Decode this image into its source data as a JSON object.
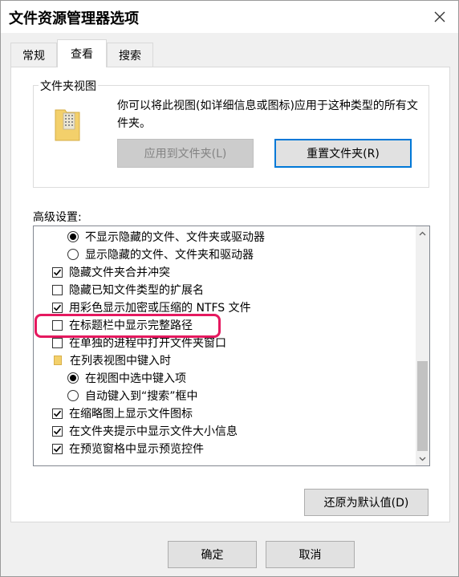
{
  "window": {
    "title": "文件资源管理器选项",
    "close_icon": "close-icon"
  },
  "tabs": [
    {
      "label": "常规",
      "active": false
    },
    {
      "label": "查看",
      "active": true
    },
    {
      "label": "搜索",
      "active": false
    }
  ],
  "folder_views": {
    "group_label": "文件夹视图",
    "icon": "folder-grid-icon",
    "description": "你可以将此视图(如详细信息或图标)应用于这种类型的所有文件夹。",
    "apply_button": "应用到文件夹(L)",
    "reset_button": "重置文件夹(R)"
  },
  "advanced": {
    "label": "高级设置:",
    "items": [
      {
        "label": "不显示隐藏的文件、文件夹或驱动器",
        "type": "radio",
        "checked": true,
        "level": 1
      },
      {
        "label": "显示隐藏的文件、文件夹和驱动器",
        "type": "radio",
        "checked": false,
        "level": 1
      },
      {
        "label": "隐藏文件夹合并冲突",
        "type": "checkbox",
        "checked": true,
        "level": 0
      },
      {
        "label": "隐藏已知文件类型的扩展名",
        "type": "checkbox",
        "checked": false,
        "level": 0
      },
      {
        "label": "用彩色显示加密或压缩的 NTFS 文件",
        "type": "checkbox",
        "checked": true,
        "level": 0
      },
      {
        "label": "在标题栏中显示完整路径",
        "type": "checkbox",
        "checked": false,
        "level": 0
      },
      {
        "label": "在单独的进程中打开文件夹窗口",
        "type": "checkbox",
        "checked": false,
        "level": 0
      },
      {
        "label": "在列表视图中键入时",
        "type": "folder",
        "checked": null,
        "level": 0
      },
      {
        "label": "在视图中选中键入项",
        "type": "radio",
        "checked": true,
        "level": 1
      },
      {
        "label": "自动键入到“搜索”框中",
        "type": "radio",
        "checked": false,
        "level": 1
      },
      {
        "label": "在缩略图上显示文件图标",
        "type": "checkbox",
        "checked": true,
        "level": 0
      },
      {
        "label": "在文件夹提示中显示文件大小信息",
        "type": "checkbox",
        "checked": true,
        "level": 0
      },
      {
        "label": "在预览窗格中显示预览控件",
        "type": "checkbox",
        "checked": true,
        "level": 0
      }
    ],
    "restore_button": "还原为默认值(D)"
  },
  "footer": {
    "ok": "确定",
    "cancel": "取消"
  },
  "colors": {
    "accent": "#0078d7",
    "highlight": "#e5195f",
    "folder": "#f3d06b"
  }
}
